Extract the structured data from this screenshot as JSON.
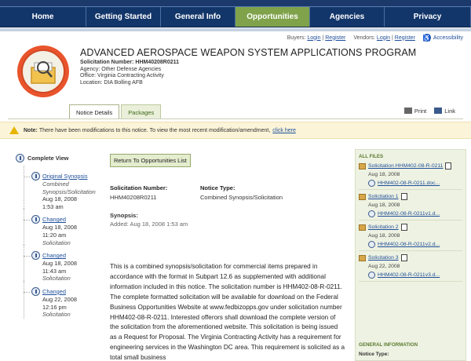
{
  "nav": {
    "tabs": [
      {
        "label": "Home",
        "width": 110
      },
      {
        "label": "Getting Started",
        "width": 95
      },
      {
        "label": "General Info",
        "width": 95
      },
      {
        "label": "Opportunities",
        "width": 95,
        "active": true
      },
      {
        "label": "Agencies",
        "width": 95
      },
      {
        "label": "Privacy",
        "width": 110
      }
    ]
  },
  "util": {
    "buyers_label": "Buyers:",
    "buyers_login": "Login",
    "sep1": "|",
    "buyers_register": "Register",
    "vendors_label": "Vendors:",
    "vendors_login": "Login",
    "sep2": "|",
    "vendors_register": "Register",
    "accessibility": "Accessibility"
  },
  "header": {
    "title": "ADVANCED AEROSPACE WEAPON SYSTEM APPLICATIONS PROGRAM",
    "sol_number_label": "Solicitation Number: HHM40208R0211",
    "agency": "Agency: Other Defense Agencies",
    "office": "Office: Virginia Contracting Activity",
    "location": "Location: DIA Bolling AFB"
  },
  "detail_tabs": {
    "notice_details": "Notice Details",
    "packages": "Packages",
    "print": "Print",
    "link": "Link"
  },
  "note": {
    "label": "Note:",
    "text": "There have been modifications to this notice. To view the most recent modification/amendment,",
    "link": "click here"
  },
  "sidebar": {
    "complete_view": "Complete View",
    "items": [
      {
        "link": "Original Synopsis",
        "type": "Combined Synopsis/Solicitation",
        "date": "Aug 18, 2008",
        "time": "1:53 am"
      },
      {
        "link": "Changed",
        "type": "Solicitation",
        "date": "Aug 18, 2008",
        "time": "11:20 am"
      },
      {
        "link": "Changed",
        "type": "Solicitation",
        "date": "Aug 18, 2008",
        "time": "11:43 am"
      },
      {
        "link": "Changed",
        "type": "Solicitation",
        "date": "Aug 22, 2008",
        "time": "12:16 pm"
      }
    ]
  },
  "main": {
    "return_button": "Return To Opportunities List",
    "sol_label": "Solicitation Number:",
    "sol_value": "HHM40208R0211",
    "notice_type_label": "Notice Type:",
    "notice_type_value": "Combined Synopsis/Solicitation",
    "synopsis_label": "Synopsis:",
    "synopsis_added": "Added: Aug 18, 2008 1:53 am",
    "body": "This is a combined synopsis/solicitation for commercial items prepared in accordance with the format in Subpart 12.6 as supplemented with additional information included in this notice. The solicitation number is HHM402-08-R-0211. The complete formatted solicitation will be available for download on the Federal Business Opportunities Website at www.fedbizopps.gov under solicitation number HHM402-08-R-0211. Interested offerors shall download the complete version of the solicitation from the aforementioned website. This solicitation is being issued as a Request for Proposal. The Virginia Contracting Activity has a requirement for engineering services in the Washington DC area. This requirement is solicited as a total small business"
  },
  "right": {
    "all_files": "ALL FILES",
    "files": [
      {
        "name": "Solicitation HHM402-08-R-0211",
        "date": "Aug 18, 2008",
        "file": "HHM402-08-R-0211.doc..."
      },
      {
        "name": "Solicitation 1",
        "date": "Aug 18, 2008",
        "file": "HHM402-08-R-0211v1.d..."
      },
      {
        "name": "Solicitation 2",
        "date": "Aug 18, 2008",
        "file": "HHM402-08-R-0211v2.d..."
      },
      {
        "name": "Solicitation 3",
        "date": "Aug 22, 2008",
        "file": "HHM402-08-R-0211v3.d..."
      }
    ],
    "general_info": "GENERAL INFORMATION",
    "notice_type_label": "Notice Type:"
  }
}
